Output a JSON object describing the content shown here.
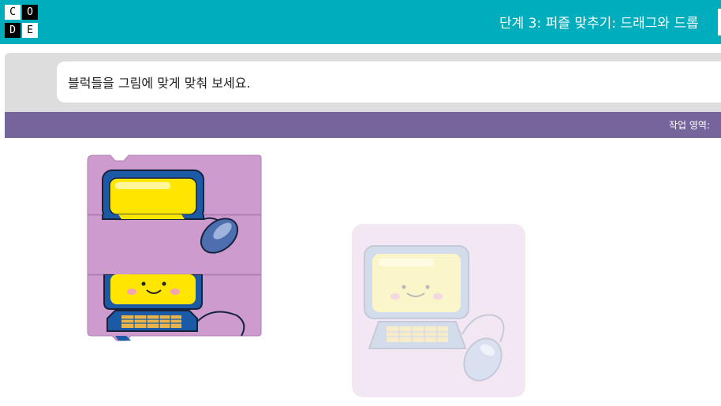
{
  "header": {
    "logo_letters": [
      "C",
      "O",
      "D",
      "E"
    ],
    "title": "단계 3: 퍼즐 맞추기: 드래그와 드롭"
  },
  "instructions": {
    "text": "블럭들을 그림에 맞게 맞춰 보세요."
  },
  "workspace": {
    "label": "작업 영역:"
  },
  "colors": {
    "header": "#00adbc",
    "workspace_bar": "#76649d",
    "block": "#cd9bcd",
    "ghost": "#f4e7f4"
  },
  "puzzle": {
    "block_count": 3,
    "subject": "computer-character"
  }
}
